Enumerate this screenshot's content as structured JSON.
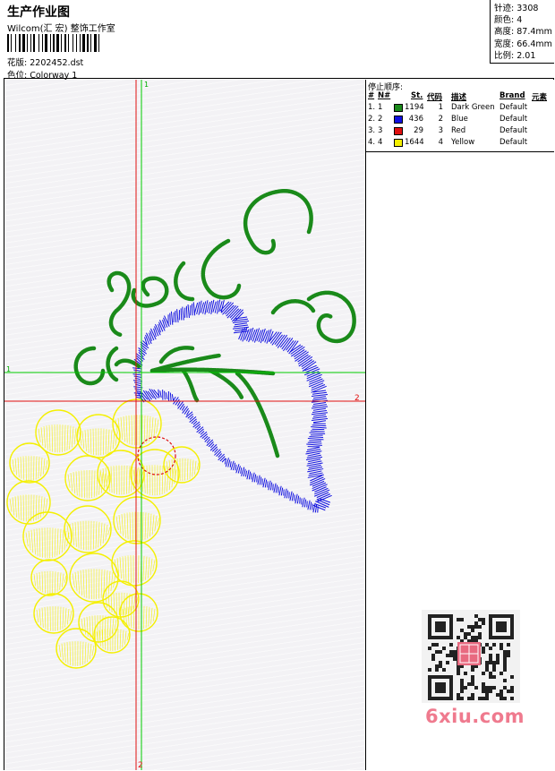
{
  "header": {
    "title": "生产作业图",
    "studio": "Wilcom(汇 宏) 整饰工作室",
    "filename_label": "花版:",
    "filename": "2202452.dst",
    "colorway_label": "色位:",
    "colorway": "Colorway 1"
  },
  "stats": [
    {
      "label": "针迹:",
      "value": "3308"
    },
    {
      "label": "颜色:",
      "value": "4"
    },
    {
      "label": "高度:",
      "value": "87.4mm"
    },
    {
      "label": "宽度:",
      "value": "66.4mm"
    },
    {
      "label": "比例:",
      "value": "2.01"
    }
  ],
  "sequence": {
    "title": "停止顺序:",
    "headers": {
      "hash": "#",
      "n": "N#",
      "st": "St.",
      "code": "代码",
      "desc": "描述",
      "brand": "Brand",
      "elem": "元素"
    },
    "rows": [
      {
        "num": "1.",
        "n": "1",
        "color": "#1a8a1a",
        "st": "1194",
        "code": "1",
        "desc": "Dark Green",
        "brand": "Default"
      },
      {
        "num": "2.",
        "n": "2",
        "color": "#1010e0",
        "st": "436",
        "code": "2",
        "desc": "Blue",
        "brand": "Default"
      },
      {
        "num": "3.",
        "n": "3",
        "color": "#e01010",
        "st": "29",
        "code": "3",
        "desc": "Red",
        "brand": "Default"
      },
      {
        "num": "4.",
        "n": "4",
        "color": "#f4f000",
        "st": "1644",
        "code": "4",
        "desc": "Yellow",
        "brand": "Default"
      }
    ]
  },
  "axes": {
    "v_top": "1",
    "h_left": "1",
    "h_right": "2",
    "v_bottom": "2"
  },
  "watermark": "6xiu.com",
  "colors": {
    "green": "#1a8a1a",
    "blue": "#1010e0",
    "red": "#e01010",
    "yellow": "#f4f000"
  }
}
